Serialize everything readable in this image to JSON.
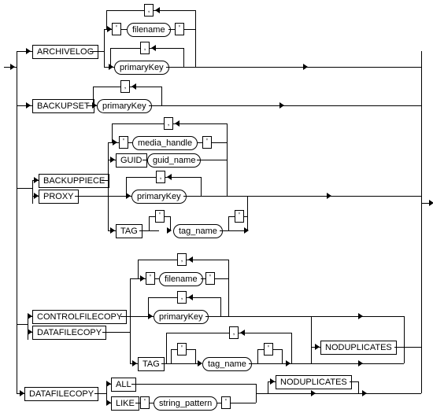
{
  "labels": {
    "archivelog": "ARCHIVELOG",
    "backupset": "BACKUPSET",
    "backuppiece": "BACKUPPIECE",
    "proxy": "PROXY",
    "controlfilecopy": "CONTROLFILECOPY",
    "datafilecopy1": "DATAFILECOPY",
    "datafilecopy2": "DATAFILECOPY",
    "guid": "GUID",
    "tag1": "TAG",
    "tag2": "TAG",
    "all": "ALL",
    "like": "LIKE",
    "noduplicates1": "NODUPLICATES",
    "noduplicates2": "NODUPLICATES"
  },
  "pills": {
    "filename1": "filename",
    "primaryKey1": "primaryKey",
    "primaryKey2": "primaryKey",
    "media_handle": "media_handle",
    "guid_name": "guid_name",
    "primaryKey3": "primaryKey",
    "tag_name1": "tag_name",
    "filename2": "filename",
    "primaryKey4": "primaryKey",
    "tag_name2": "tag_name",
    "string_pattern": "string_pattern"
  },
  "quotes": {
    "q": "'",
    "comma": ","
  }
}
